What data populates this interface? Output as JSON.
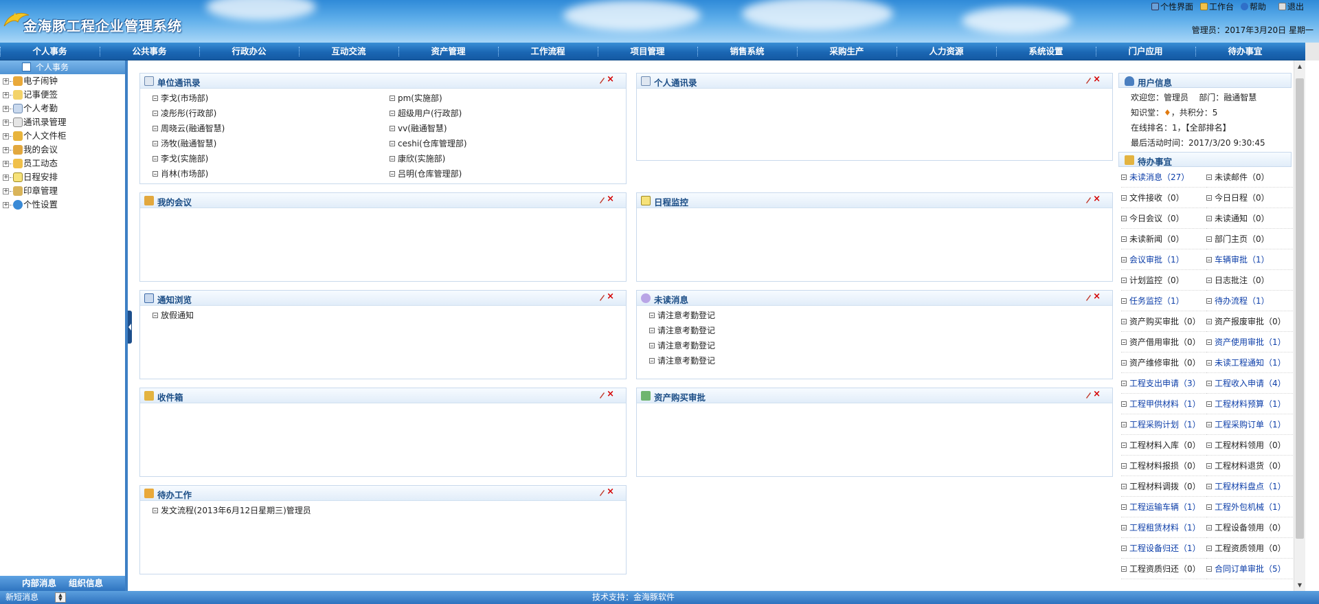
{
  "header": {
    "title": "金海豚工程企业管理系统",
    "top_links": [
      "个性界面",
      "工作台",
      "帮助",
      "退出"
    ],
    "user_line": "管理员：2017年3月20日 星期一"
  },
  "nav": [
    "个人事务",
    "公共事务",
    "行政办公",
    "互动交流",
    "资产管理",
    "工作流程",
    "项目管理",
    "销售系统",
    "采购生产",
    "人力资源",
    "系统设置",
    "门户应用",
    "待办事宜"
  ],
  "sidebar": {
    "title": "个人事务",
    "items": [
      "电子闹钟",
      "记事便签",
      "个人考勤",
      "通讯录管理",
      "个人文件柜",
      "我的会议",
      "员工动态",
      "日程安排",
      "印章管理",
      "个性设置"
    ],
    "bottom_tabs": [
      "内部消息",
      "组织信息"
    ]
  },
  "panels": {
    "unit_contacts": {
      "title": "单位通讯录",
      "col1": [
        "李戈(市场部)",
        "凌彤彤(行政部)",
        "周晓云(融通智慧)",
        "汤牧(融通智慧)",
        "李戈(实施部)",
        "肖林(市场部)"
      ],
      "col2": [
        "pm(实施部)",
        "超级用户(行政部)",
        "vv(融通智慧)",
        "ceshi(仓库管理部)",
        "康欣(实施部)",
        "吕明(仓库管理部)"
      ]
    },
    "personal_contacts": {
      "title": "个人通讯录"
    },
    "my_meetings": {
      "title": "我的会议"
    },
    "schedule_monitor": {
      "title": "日程监控"
    },
    "notice_browse": {
      "title": "通知浏览",
      "items": [
        "放假通知"
      ]
    },
    "unread_messages": {
      "title": "未读消息",
      "items": [
        "请注意考勤登记",
        "请注意考勤登记",
        "请注意考勤登记",
        "请注意考勤登记"
      ]
    },
    "inbox": {
      "title": "收件箱"
    },
    "asset_purchase": {
      "title": "资产购买审批"
    },
    "todo_work": {
      "title": "待办工作",
      "items": [
        "发文流程(2013年6月12日星期三)管理员"
      ]
    }
  },
  "user_info": {
    "title": "用户信息",
    "welcome": "欢迎您：管理员",
    "dept": "部门：融通智慧",
    "knowledge_label": "知识堂：",
    "points": "，共积分：5",
    "online_rank": "在线排名：1，【全部排名】",
    "last_active": "最后活动时间：2017/3/20 9:30:45"
  },
  "todo_matters": {
    "title": "待办事宜",
    "items": [
      {
        "label": "未读消息（27）",
        "blue": true
      },
      {
        "label": "未读邮件（0）",
        "blue": false
      },
      {
        "label": "文件接收（0）",
        "blue": false
      },
      {
        "label": "今日日程（0）",
        "blue": false
      },
      {
        "label": "今日会议（0）",
        "blue": false
      },
      {
        "label": "未读通知（0）",
        "blue": false
      },
      {
        "label": "未读新闻（0）",
        "blue": false
      },
      {
        "label": "部门主页（0）",
        "blue": false
      },
      {
        "label": "会议审批（1）",
        "blue": true
      },
      {
        "label": "车辆审批（1）",
        "blue": true
      },
      {
        "label": "计划监控（0）",
        "blue": false
      },
      {
        "label": "日志批注（0）",
        "blue": false
      },
      {
        "label": "任务监控（1）",
        "blue": true
      },
      {
        "label": "待办流程（1）",
        "blue": true
      },
      {
        "label": "资产购买审批（0）",
        "blue": false
      },
      {
        "label": "资产报废审批（0）",
        "blue": false
      },
      {
        "label": "资产借用审批（0）",
        "blue": false
      },
      {
        "label": "资产使用审批（1）",
        "blue": true
      },
      {
        "label": "资产维修审批（0）",
        "blue": false
      },
      {
        "label": "未读工程通知（1）",
        "blue": true
      },
      {
        "label": "工程支出申请（3）",
        "blue": true
      },
      {
        "label": "工程收入申请（4）",
        "blue": true
      },
      {
        "label": "工程甲供材料（1）",
        "blue": true
      },
      {
        "label": "工程材料预算（1）",
        "blue": true
      },
      {
        "label": "工程采购计划（1）",
        "blue": true
      },
      {
        "label": "工程采购订单（1）",
        "blue": true
      },
      {
        "label": "工程材料入库（0）",
        "blue": false
      },
      {
        "label": "工程材料领用（0）",
        "blue": false
      },
      {
        "label": "工程材料报损（0）",
        "blue": false
      },
      {
        "label": "工程材料退货（0）",
        "blue": false
      },
      {
        "label": "工程材料调拨（0）",
        "blue": false
      },
      {
        "label": "工程材料盘点（1）",
        "blue": true
      },
      {
        "label": "工程运输车辆（1）",
        "blue": true
      },
      {
        "label": "工程外包机械（1）",
        "blue": true
      },
      {
        "label": "工程租赁材料（1）",
        "blue": true
      },
      {
        "label": "工程设备领用（0）",
        "blue": false
      },
      {
        "label": "工程设备归还（1）",
        "blue": true
      },
      {
        "label": "工程资质领用（0）",
        "blue": false
      },
      {
        "label": "工程资质归还（0）",
        "blue": false
      },
      {
        "label": "合同订单审批（5）",
        "blue": true
      }
    ]
  },
  "status_bar": {
    "message": "新短消息",
    "support": "技术支持：金海豚软件"
  },
  "colors": {
    "nav_bg": "#1b67b4",
    "panel_title": "#1b4d86",
    "link_blue": "#0b3da8",
    "close_red": "#d40000"
  }
}
